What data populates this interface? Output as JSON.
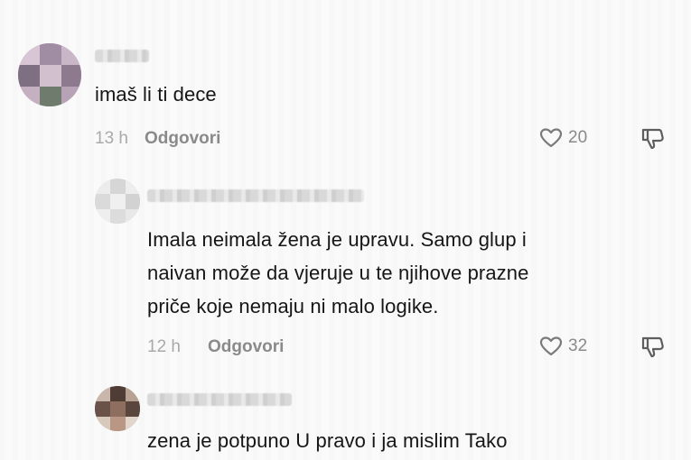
{
  "comments": [
    {
      "text": "imaš li ti dece",
      "time": "13 h",
      "reply_label": "Odgovori",
      "likes": "20"
    },
    {
      "text": "Imala neimala žena je upravu. Samo glup i\nnaivan može da vjeruje u te njihove prazne\npriče koje nemaju ni malo logike.",
      "time": "12 h",
      "reply_label": "Odgovori",
      "likes": "32"
    },
    {
      "text": "zena je potpuno U pravo i ja mislim Tako"
    }
  ],
  "icons": {
    "like": "heart-outline-icon",
    "dislike": "thumbs-down-icon"
  },
  "colors": {
    "text": "#161616",
    "muted": "#8a8a8a",
    "time": "#a9a9a9",
    "background": "#fafafa"
  }
}
